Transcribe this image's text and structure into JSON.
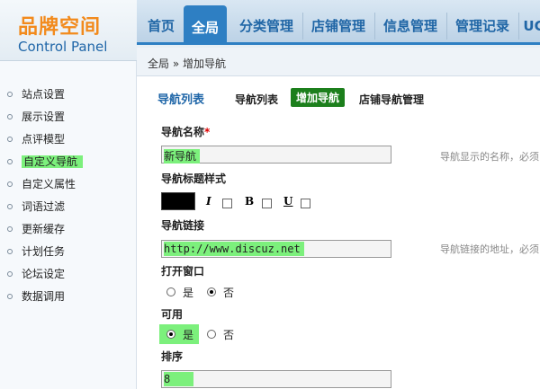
{
  "header": {
    "logo_cn": "品牌空间",
    "logo_en": "Control Panel",
    "nav": [
      {
        "label": "首页",
        "active": false
      },
      {
        "label": "全局",
        "active": true
      },
      {
        "label": "分类管理",
        "active": false
      },
      {
        "label": "店铺管理",
        "active": false
      },
      {
        "label": "信息管理",
        "active": false
      },
      {
        "label": "管理记录",
        "active": false
      },
      {
        "label": "UC",
        "active": false
      }
    ]
  },
  "breadcrumb": "全局 » 增加导航",
  "sidebar": {
    "items": [
      {
        "label": "站点设置",
        "active": false
      },
      {
        "label": "展示设置",
        "active": false
      },
      {
        "label": "点评模型",
        "active": false
      },
      {
        "label": "自定义导航",
        "active": true
      },
      {
        "label": "自定义属性",
        "active": false
      },
      {
        "label": "词语过滤",
        "active": false
      },
      {
        "label": "更新缓存",
        "active": false
      },
      {
        "label": "计划任务",
        "active": false
      },
      {
        "label": "论坛设定",
        "active": false
      },
      {
        "label": "数据调用",
        "active": false
      }
    ]
  },
  "content": {
    "section_title": "导航列表",
    "subtabs": [
      {
        "label": "导航列表",
        "active": false
      },
      {
        "label": "增加导航",
        "active": true
      },
      {
        "label": "店铺导航管理",
        "active": false
      }
    ],
    "nav_name": {
      "label": "导航名称",
      "required_mark": "*",
      "value": "新导航",
      "hint": "导航显示的名称，必须"
    },
    "title_style": {
      "label": "导航标题样式",
      "color": "#000000",
      "italic_label": "I",
      "bold_label": "B",
      "underline_label": "U"
    },
    "nav_link": {
      "label": "导航链接",
      "value": "http://www.discuz.net",
      "hint": "导航链接的地址，必须"
    },
    "open_window": {
      "label": "打开窗口",
      "yes": "是",
      "no": "否",
      "selected": "no"
    },
    "enabled": {
      "label": "可用",
      "yes": "是",
      "no": "否",
      "selected": "yes"
    },
    "order": {
      "label": "排序",
      "value": "8"
    }
  }
}
